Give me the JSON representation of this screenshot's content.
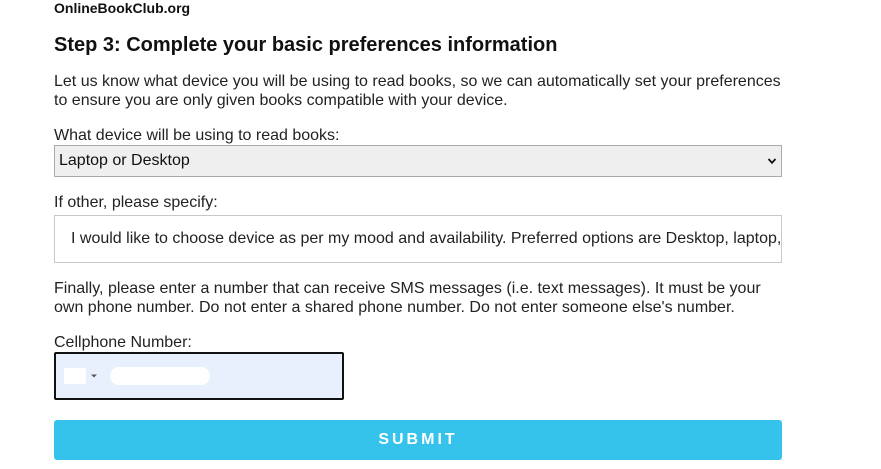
{
  "header": {
    "site_name": "OnlineBookClub.org"
  },
  "form": {
    "heading": "Step 3: Complete your basic preferences information",
    "intro": "Let us know what device you will be using to read books, so we can automatically set your preferences to ensure you are only given books compatible with your device.",
    "device_label": "What device will be using to read books:",
    "device_selected": "Laptop or Desktop",
    "other_label": "If other, please specify:",
    "other_value": "I would like to choose device as per my mood and availability. Preferred options are Desktop, laptop,",
    "sms_text": "Finally, please enter a number that can receive SMS messages (i.e. text messages). It must be your own phone number. Do not enter a shared phone number. Do not enter someone else's number.",
    "phone_label": "Cellphone Number:",
    "submit_label": "SUBMIT"
  },
  "colors": {
    "submit_bg": "#35c3ec",
    "phone_field_bg": "#e8f0fe",
    "select_bg": "#efefef"
  },
  "icons": {
    "select_arrow": "chevron-down-icon",
    "country_arrow": "caret-down-icon"
  }
}
